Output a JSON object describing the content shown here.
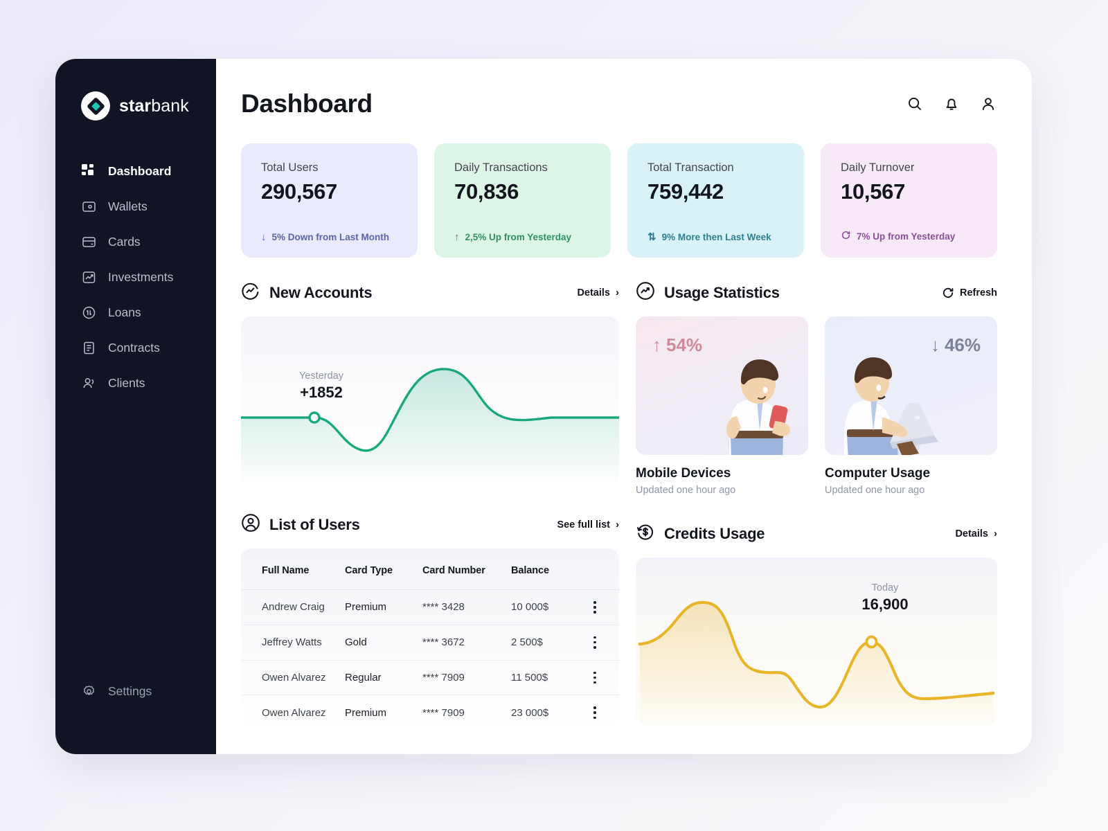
{
  "brand": {
    "name_bold": "star",
    "name_light": "bank",
    "logo_icon": "diamond-logo-icon"
  },
  "sidebar": {
    "items": [
      {
        "label": "Dashboard",
        "icon": "grid-icon",
        "active": true
      },
      {
        "label": "Wallets",
        "icon": "wallet-icon",
        "active": false
      },
      {
        "label": "Cards",
        "icon": "card-icon",
        "active": false
      },
      {
        "label": "Investments",
        "icon": "trending-up-icon",
        "active": false
      },
      {
        "label": "Loans",
        "icon": "exchange-circle-icon",
        "active": false
      },
      {
        "label": "Contracts",
        "icon": "document-icon",
        "active": false
      },
      {
        "label": "Clients",
        "icon": "users-icon",
        "active": false
      }
    ],
    "bottom": {
      "label": "Settings",
      "icon": "gear-icon"
    }
  },
  "header": {
    "title": "Dashboard",
    "actions": [
      {
        "name": "search-icon"
      },
      {
        "name": "bell-icon"
      },
      {
        "name": "user-icon"
      }
    ]
  },
  "stats": [
    {
      "label": "Total Users",
      "value": "290,567",
      "delta": "5% Down from Last Month",
      "delta_icon": "arrow-down-icon",
      "bg": "#e9eafc",
      "delta_color": "#5c63a8"
    },
    {
      "label": "Daily Transactions",
      "value": "70,836",
      "delta": "2,5% Up from Yesterday",
      "delta_icon": "arrow-up-icon",
      "bg": "#ddf5e6",
      "delta_color": "#2f9160"
    },
    {
      "label": "Total Transaction",
      "value": "759,442",
      "delta": "9% More then Last Week",
      "delta_icon": "arrows-updown-icon",
      "bg": "#d9f2f8",
      "delta_color": "#2d7f8f"
    },
    {
      "label": "Daily Turnover",
      "value": "10,567",
      "delta": "7% Up from Yesterday",
      "delta_icon": "refresh-circle-icon",
      "bg": "#f7e9f7",
      "delta_color": "#8a4e96"
    }
  ],
  "new_accounts": {
    "title": "New Accounts",
    "icon": "activity-circle-icon",
    "link": "Details",
    "tooltip_label": "Yesterday",
    "tooltip_value": "+1852",
    "line_color": "#18a87b"
  },
  "usage_statistics": {
    "title": "Usage Statistics",
    "icon": "activity-circle-icon",
    "link": "Refresh",
    "link_icon": "refresh-icon",
    "cards": [
      {
        "pct": "54%",
        "direction": "up",
        "dir_icon": "arrow-up-icon",
        "name": "Mobile Devices",
        "sub": "Updated one hour ago"
      },
      {
        "pct": "46%",
        "direction": "down",
        "dir_icon": "arrow-down-icon",
        "name": "Computer Usage",
        "sub": "Updated one hour ago"
      }
    ]
  },
  "list_of_users": {
    "title": "List of Users",
    "icon": "user-circle-icon",
    "link": "See full list",
    "columns": [
      "Full Name",
      "Card Type",
      "Card Number",
      "Balance"
    ],
    "rows": [
      {
        "name": "Andrew Craig",
        "card_type": "Premium",
        "card_number": "**** 3428",
        "balance": "10 000$"
      },
      {
        "name": "Jeffrey Watts",
        "card_type": "Gold",
        "card_number": "**** 3672",
        "balance": "2 500$"
      },
      {
        "name": "Owen Alvarez",
        "card_type": "Regular",
        "card_number": "**** 7909",
        "balance": "11 500$"
      },
      {
        "name": "Owen Alvarez",
        "card_type": "Premium",
        "card_number": "**** 7909",
        "balance": "23 000$"
      }
    ]
  },
  "credits_usage": {
    "title": "Credits Usage",
    "icon": "dollar-circle-icon",
    "link": "Details",
    "tooltip_label": "Today",
    "tooltip_value": "16,900",
    "line_color": "#e8b428"
  },
  "chart_data": [
    {
      "type": "area",
      "title": "New Accounts",
      "xlabel": "",
      "ylabel": "",
      "grid": false,
      "legend": "none",
      "line_color": "#18a87b",
      "annotations": [
        {
          "label": "Yesterday",
          "value": "+1852",
          "x_index": 2
        }
      ],
      "x": [
        0,
        1,
        2,
        3,
        4,
        5,
        6,
        7,
        8,
        9,
        10
      ],
      "values": [
        1852,
        1852,
        1852,
        1852,
        1180,
        1500,
        3050,
        3320,
        2400,
        1900,
        1860
      ]
    },
    {
      "type": "area",
      "title": "Credits Usage",
      "xlabel": "",
      "ylabel": "",
      "grid": false,
      "legend": "none",
      "line_color": "#e8b428",
      "annotations": [
        {
          "label": "Today",
          "value": "16,900",
          "x_index": 7
        }
      ],
      "x": [
        0,
        1,
        2,
        3,
        4,
        5,
        6,
        7,
        8,
        9
      ],
      "values": [
        12800,
        15800,
        15300,
        11700,
        11200,
        7200,
        9000,
        16900,
        14000,
        11000
      ]
    }
  ]
}
